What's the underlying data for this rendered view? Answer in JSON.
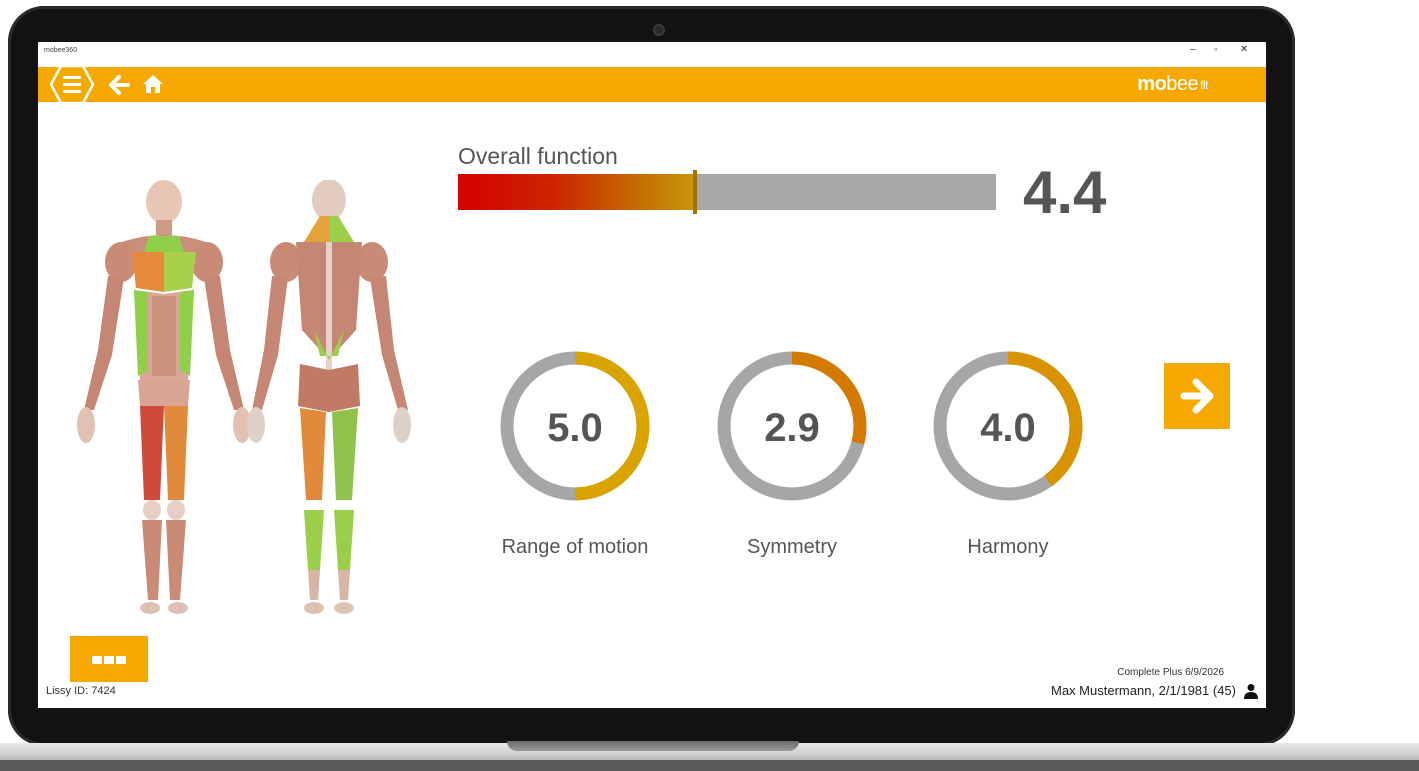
{
  "window": {
    "title": "mobee360",
    "controls": {
      "minimize": "–",
      "restore": "▫",
      "close": "✕"
    }
  },
  "appbar": {
    "brand_bold": "mo",
    "brand_light": "bee",
    "brand_suffix": "fit",
    "accent": "#f5a800"
  },
  "overall": {
    "title": "Overall function",
    "value": "4.4",
    "level": 0.44
  },
  "metrics": [
    {
      "label": "Range of motion",
      "value": "5.0",
      "fraction": 0.5,
      "color": "#d9a400"
    },
    {
      "label": "Symmetry",
      "value": "2.9",
      "fraction": 0.29,
      "color": "#d47a00"
    },
    {
      "label": "Harmony",
      "value": "4.0",
      "fraction": 0.4,
      "color": "#d99200"
    }
  ],
  "footer": {
    "lissy_id": "Lissy ID: 7424",
    "plan": "Complete Plus 6/9/2026",
    "patient": "Max Mustermann, 2/1/1981 (45)"
  },
  "icons": {
    "menu": "menu-icon",
    "back": "arrow-left-icon",
    "home": "home-icon",
    "next": "arrow-right-icon",
    "more": "more-dots-icon",
    "user": "user-icon"
  }
}
